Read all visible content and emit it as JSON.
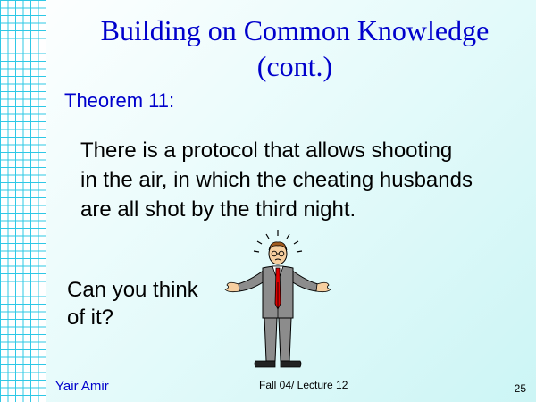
{
  "slide": {
    "title_line1": "Building on Common Knowledge",
    "title_line2": "(cont.)",
    "theorem_label": "Theorem 11:",
    "theorem_body": [
      "There is a protocol that allows shooting",
      "in the air, in which the cheating husbands",
      "are all shot by the third night."
    ],
    "question": [
      "Can you think",
      "of it?"
    ],
    "figure_icon": "shrugging-man-clipart"
  },
  "footer": {
    "author": "Yair Amir",
    "course": "Fall 04/ Lecture 12",
    "page_number": "25"
  },
  "colors": {
    "title": "#0000cc",
    "grid_lines": "#2ec8e6",
    "tie": "#dd0000",
    "suit": "#8c8c8c"
  }
}
